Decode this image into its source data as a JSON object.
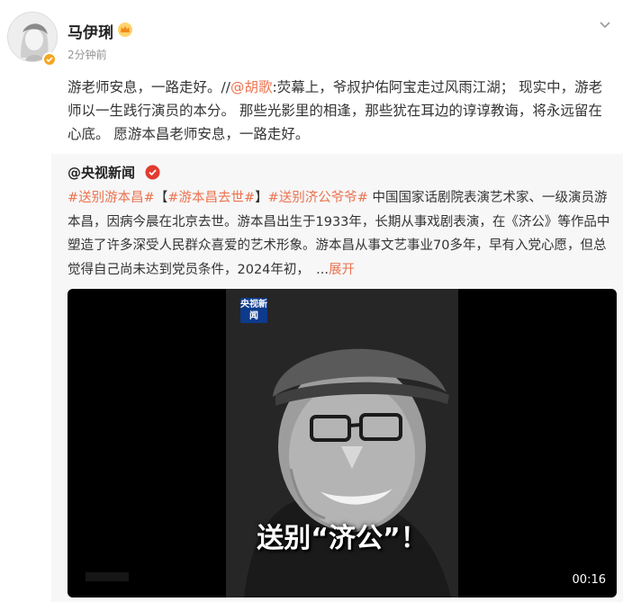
{
  "post": {
    "username": "马伊琍",
    "timestamp": "2分钟前",
    "text_part1": "游老师安息，一路走好。//",
    "mention": "@胡歌",
    "text_part2": ":荧幕上，爷叔护佑阿宝走过风雨江湖； 现实中，游老师以一生践行演员的本分。 那些光影里的相逢，那些犹在耳边的谆谆教诲，将永远留在心底。 愿游本昌老师安息，一路走好。"
  },
  "repost": {
    "username": "@央视新闻",
    "hashtag1": "#送别游本昌#",
    "bracket_open": "【",
    "hashtag2": "#游本昌去世#",
    "bracket_close": "】",
    "hashtag3": "#送别济公爷爷#",
    "text": " 中国国家话剧院表演艺术家、一级演员游本昌，因病今晨在北京去世。游本昌出生于1933年，长期从事戏剧表演，在《济公》等作品中塑造了许多深受人民群众喜爱的艺术形象。游本昌从事文艺事业70多年，早有入党心愿，但总觉得自己尚未达到党员条件，2024年初，　...",
    "expand_label": "展开"
  },
  "video": {
    "logo_text": "央视新闻",
    "caption": "送别“济公”！",
    "duration": "00:16"
  },
  "colors": {
    "link": "#eb7350",
    "video_bg": "#000000",
    "repost_bg": "#f7f7f7"
  },
  "icons": [
    "avatar",
    "vip-crown-icon",
    "chevron-down-icon",
    "verified-badge-icon"
  ]
}
